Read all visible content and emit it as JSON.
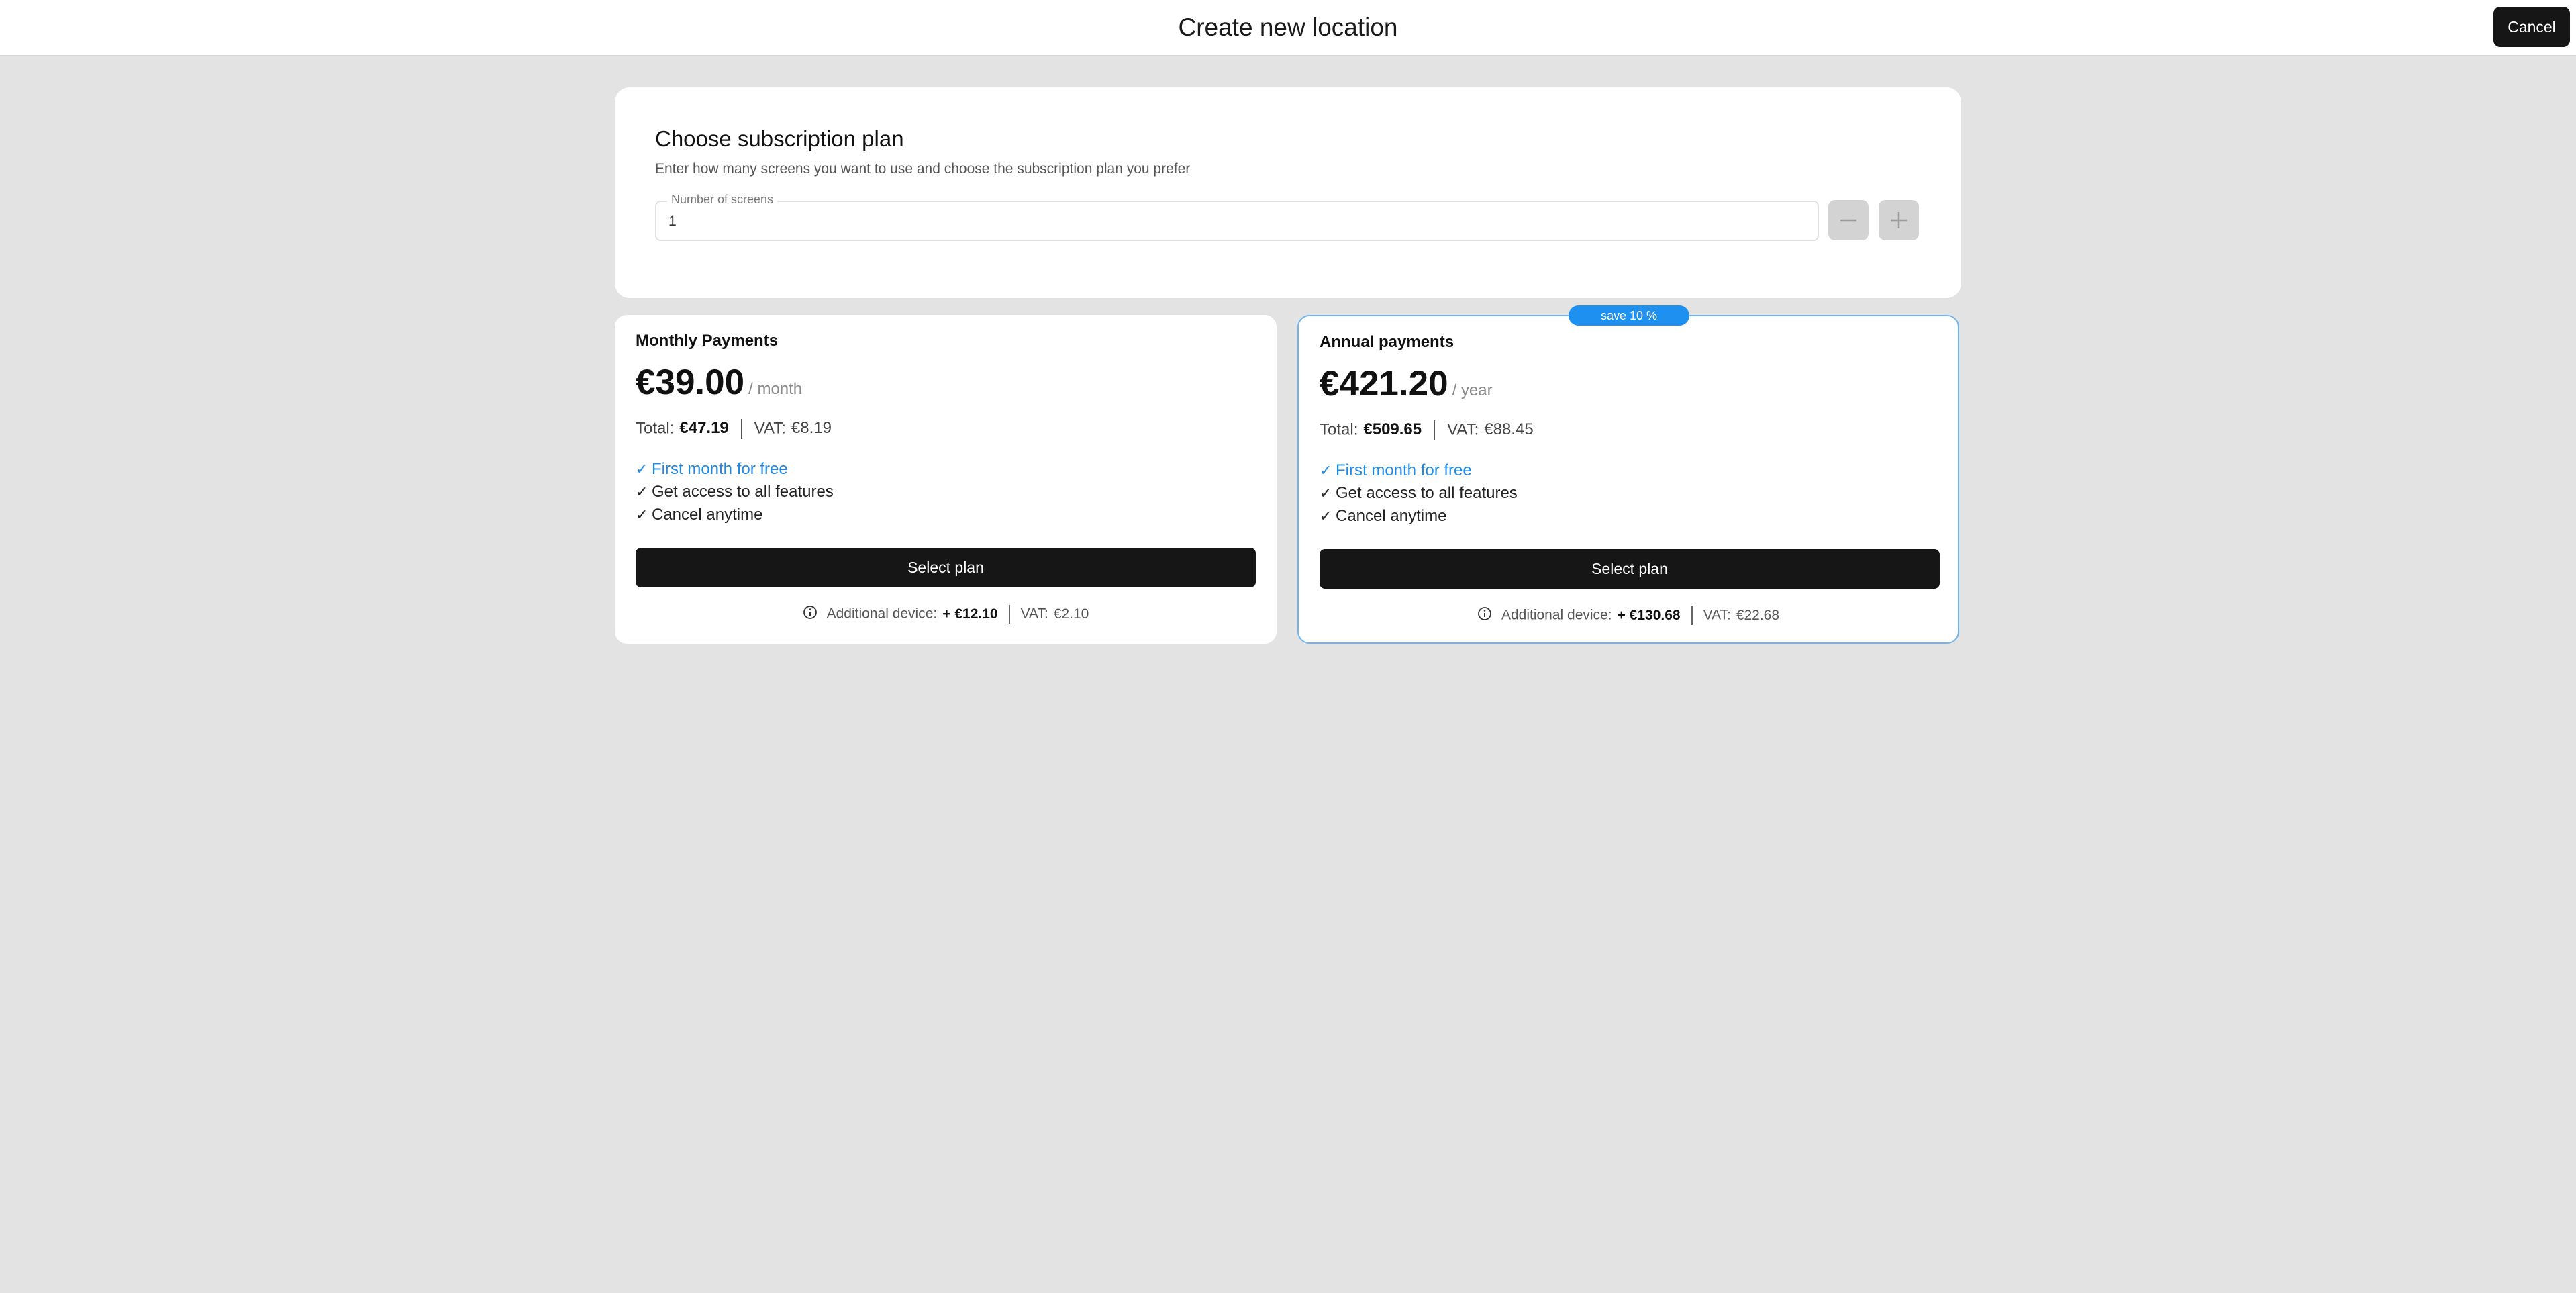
{
  "header": {
    "title": "Create new location",
    "cancel_label": "Cancel"
  },
  "subscription": {
    "title": "Choose subscription plan",
    "subtitle": "Enter how many screens you want to use and choose the subscription plan you prefer",
    "screens_label": "Number of screens",
    "screens_value": "1",
    "decrement_icon": "minus-icon",
    "increment_icon": "plus-icon"
  },
  "plans": {
    "monthly": {
      "title": "Monthly Payments",
      "price": "€39.00",
      "period": "/ month",
      "total_label": "Total:",
      "total_value": "€47.19",
      "vat_label": "VAT:",
      "vat_value": "€8.19",
      "features": [
        "First month for free",
        "Get access to all features",
        "Cancel anytime"
      ],
      "button_label": "Select plan",
      "additional_label": "Additional device:",
      "additional_value": "+ €12.10",
      "additional_vat_label": "VAT:",
      "additional_vat_value": "€2.10"
    },
    "annual": {
      "badge": "save 10 %",
      "title": "Annual payments",
      "price": "€421.20",
      "period": "/ year",
      "total_label": "Total:",
      "total_value": "€509.65",
      "vat_label": "VAT:",
      "vat_value": "€88.45",
      "features": [
        "First month for free",
        "Get access to all features",
        "Cancel anytime"
      ],
      "button_label": "Select plan",
      "additional_label": "Additional device:",
      "additional_value": "+ €130.68",
      "additional_vat_label": "VAT:",
      "additional_vat_value": "€22.68"
    }
  },
  "colors": {
    "accent": "#1e90ef",
    "button": "#161616",
    "background": "#e3e3e3"
  }
}
